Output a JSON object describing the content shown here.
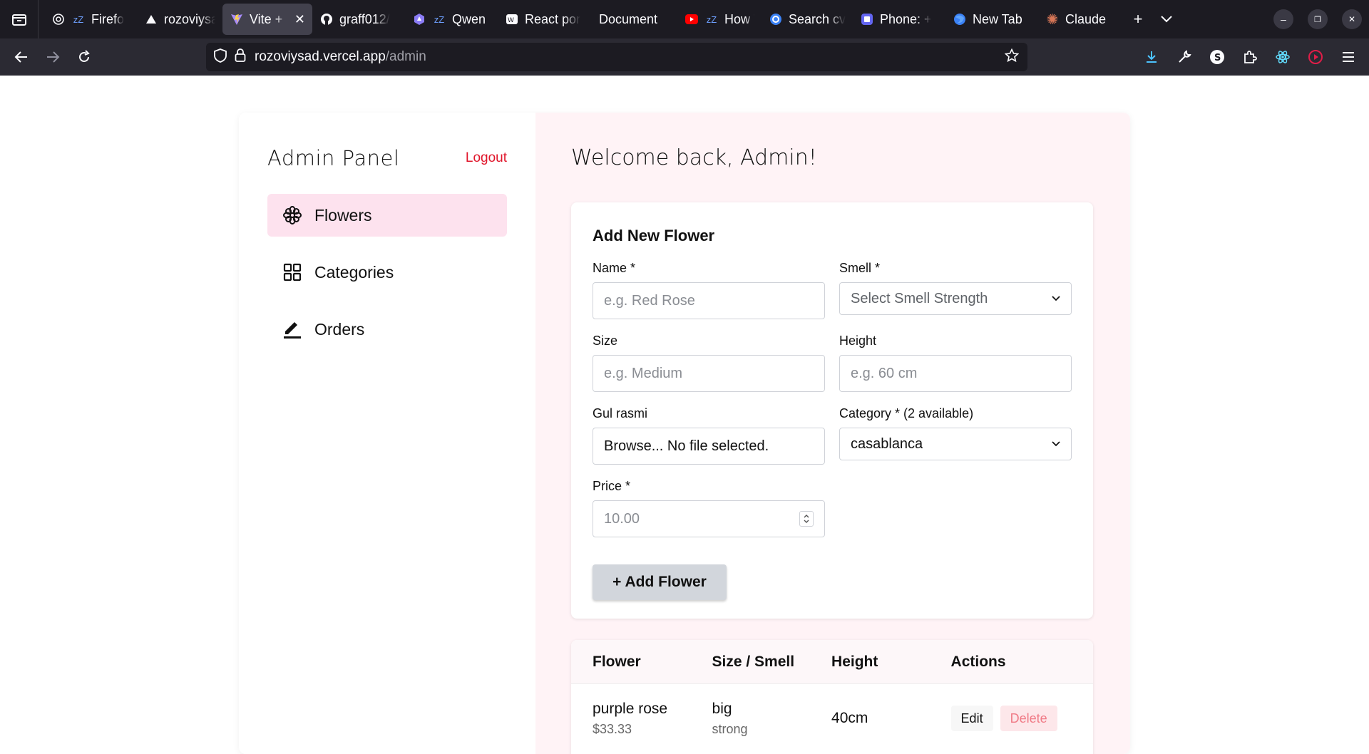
{
  "browser": {
    "tabs": [
      {
        "title": "Firefo",
        "icon": "ai-icon",
        "active": false
      },
      {
        "title": "rozoviysa",
        "icon": "vercel-icon",
        "active": false
      },
      {
        "title": "Vite + R",
        "icon": "vite-icon",
        "active": true
      },
      {
        "title": "graff012/",
        "icon": "github-icon",
        "active": false
      },
      {
        "title": "Qwen",
        "icon": "qwen-icon",
        "active": false
      },
      {
        "title": "React por",
        "icon": "react-icon",
        "active": false
      },
      {
        "title": "Document",
        "icon": "",
        "active": false
      },
      {
        "title": "How T",
        "icon": "youtube-icon",
        "active": false
      },
      {
        "title": "Search cv",
        "icon": "search-cv-icon",
        "active": false
      },
      {
        "title": "Phone: +",
        "icon": "phone-icon",
        "active": false
      },
      {
        "title": "New Tab",
        "icon": "firefox-icon",
        "active": false
      },
      {
        "title": "Claude",
        "icon": "claude-icon",
        "active": false
      }
    ],
    "url_host": "rozoviysad.vercel.app",
    "url_path": "/admin"
  },
  "sidebar": {
    "title": "Admin Panel",
    "logout": "Logout",
    "items": [
      {
        "label": "Flowers",
        "icon": "flower-icon",
        "active": true
      },
      {
        "label": "Categories",
        "icon": "grid-icon",
        "active": false
      },
      {
        "label": "Orders",
        "icon": "pen-icon",
        "active": false
      }
    ]
  },
  "main": {
    "welcome": "Welcome back, Admin!",
    "form": {
      "title": "Add New Flower",
      "name_label": "Name *",
      "name_placeholder": "e.g. Red Rose",
      "smell_label": "Smell *",
      "smell_value": "Select Smell Strength",
      "size_label": "Size",
      "size_placeholder": "e.g. Medium",
      "height_label": "Height",
      "height_placeholder": "e.g. 60 cm",
      "image_label": "Gul rasmi",
      "image_value": "Browse... No file selected.",
      "category_label": "Category * (2 available)",
      "category_value": "casablanca",
      "price_label": "Price *",
      "price_placeholder": "10.00",
      "submit": "+ Add Flower"
    },
    "table": {
      "headers": [
        "Flower",
        "Size / Smell",
        "Height",
        "Actions"
      ],
      "rows": [
        {
          "name": "purple rose",
          "price": "$33.33",
          "size": "big",
          "smell": "strong",
          "height": "40cm",
          "edit": "Edit",
          "delete": "Delete"
        }
      ]
    }
  },
  "colors": {
    "accent": "#e0162b",
    "sidebar_active": "#fde2ee",
    "main_bg": "#fff3f6"
  }
}
